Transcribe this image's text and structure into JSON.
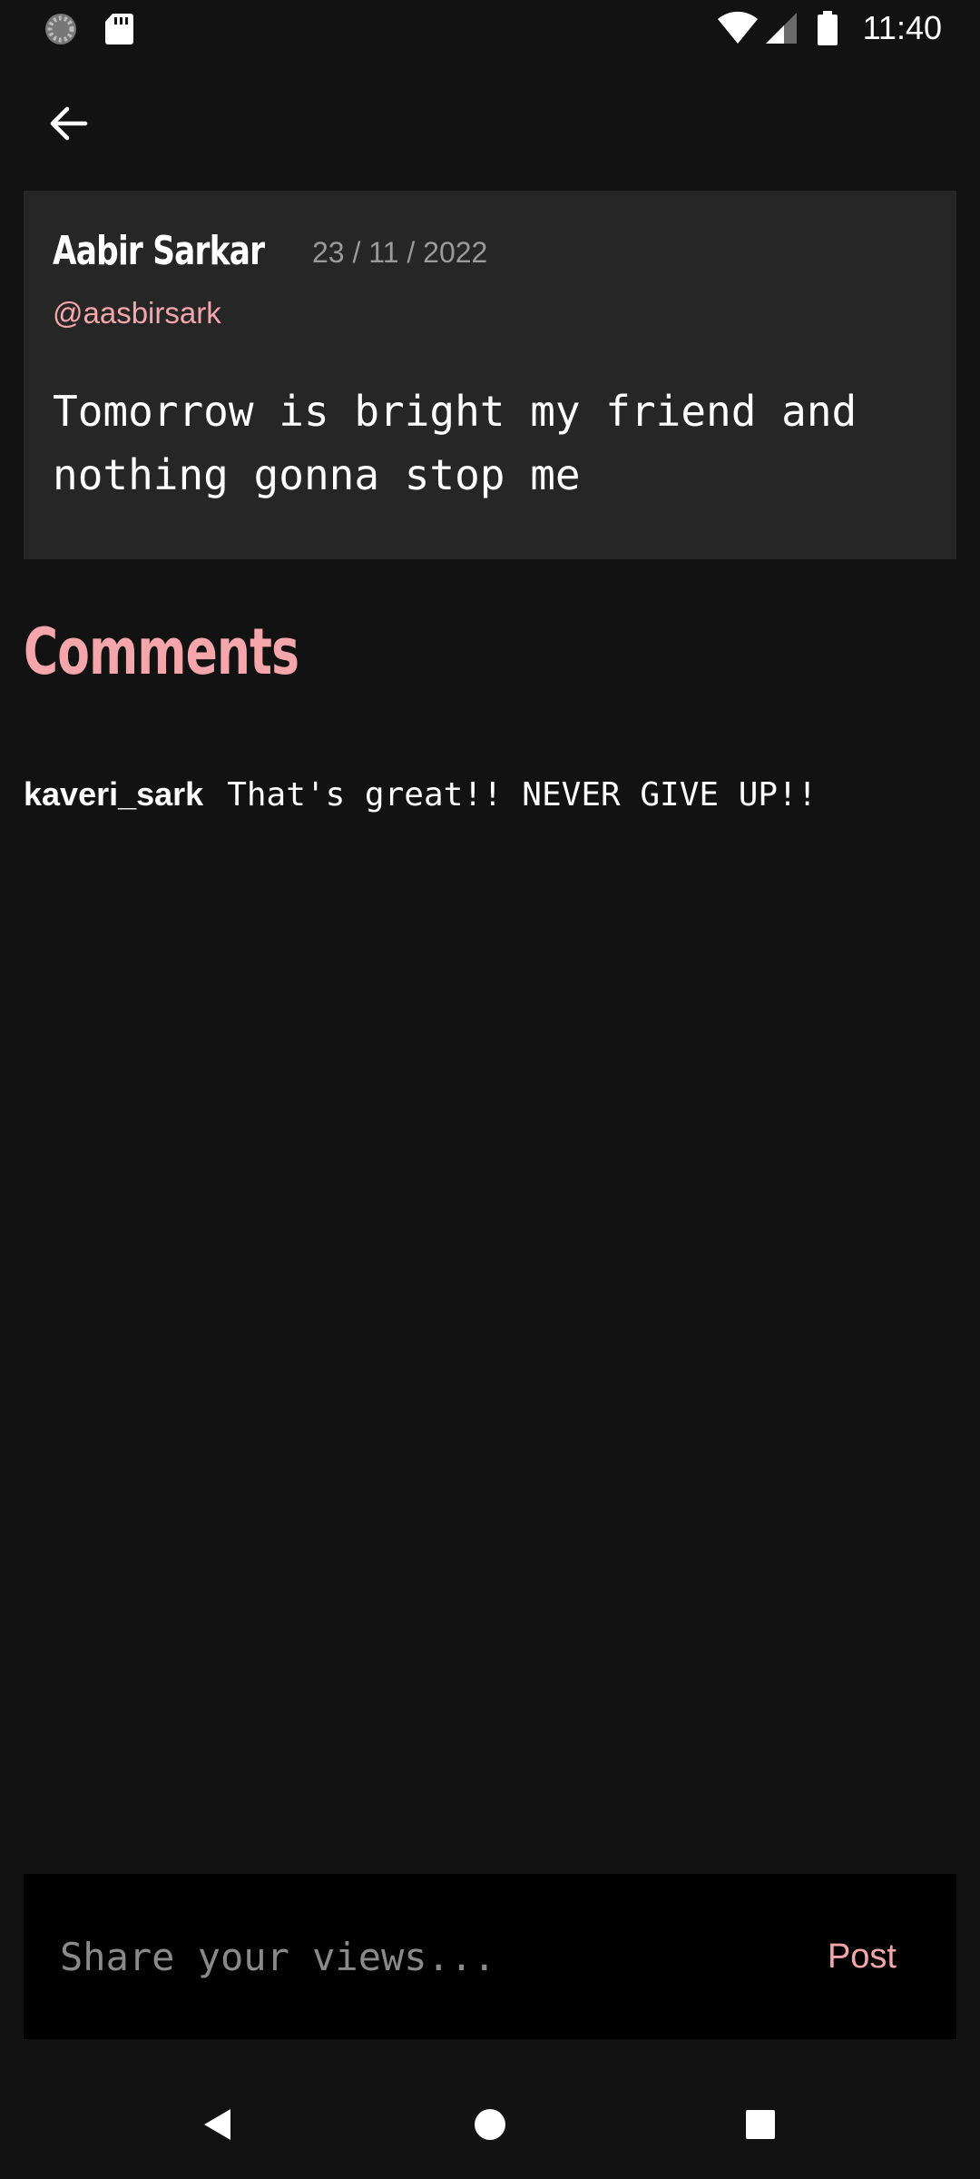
{
  "status_bar": {
    "time": "11:40",
    "icons": [
      "app-notification-icon",
      "sd-card-icon",
      "wifi-icon",
      "signal-icon",
      "battery-icon"
    ]
  },
  "app_bar": {
    "back_icon": "arrow-left-icon"
  },
  "post": {
    "author_name": "Aabir Sarkar",
    "date": "23 / 11 / 2022",
    "handle": "@aasbirsark",
    "body": "Tomorrow is bright my friend and nothing gonna stop me"
  },
  "comments": {
    "heading": "Comments",
    "items": [
      {
        "user": "kaveri_sark",
        "text": "That's great!! NEVER GIVE UP!!"
      }
    ]
  },
  "composer": {
    "placeholder": "Share your views...",
    "value": "",
    "post_label": "Post"
  },
  "nav_bar": {
    "icons": [
      "back-triangle-icon",
      "home-circle-icon",
      "recents-square-icon"
    ]
  },
  "colors": {
    "background": "#121212",
    "card": "#262626",
    "accent": "#f4a6ab",
    "composer_bg": "#000000",
    "muted_text": "#9a9a9a"
  }
}
